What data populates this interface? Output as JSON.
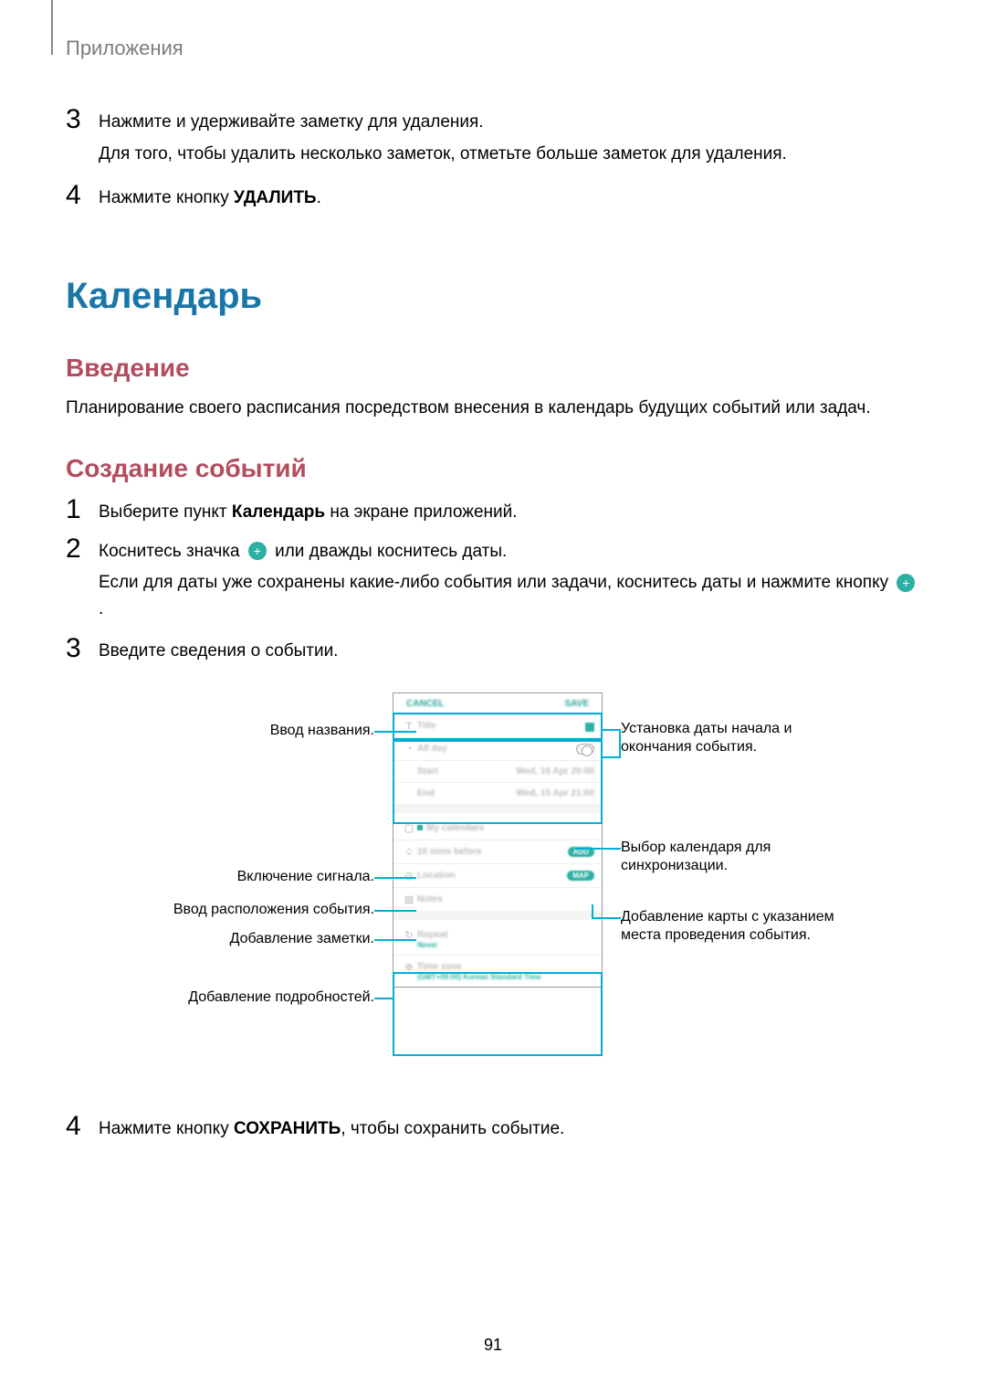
{
  "header": "Приложения",
  "steps_top": {
    "step3": {
      "num": "3",
      "line1": "Нажмите и удерживайте заметку для удаления.",
      "line2": "Для того, чтобы удалить несколько заметок, отметьте больше заметок для удаления."
    },
    "step4": {
      "num": "4",
      "prefix": "Нажмите кнопку ",
      "bold": "УДАЛИТЬ",
      "suffix": "."
    }
  },
  "section_title": "Календарь",
  "intro": {
    "heading": "Введение",
    "text": "Планирование своего расписания посредством внесения в календарь будущих событий или задач."
  },
  "create": {
    "heading": "Создание событий",
    "step1": {
      "num": "1",
      "prefix": "Выберите пункт ",
      "bold": "Календарь",
      "suffix": " на экране приложений."
    },
    "step2": {
      "num": "2",
      "part1": "Коснитесь значка ",
      "part2": " или дважды коснитесь даты.",
      "line2a": "Если для даты уже сохранены какие-либо события или задачи, коснитесь даты и нажмите кнопку ",
      "line2b": "."
    },
    "step3": {
      "num": "3",
      "text": "Введите сведения о событии."
    },
    "step4": {
      "num": "4",
      "prefix": "Нажмите кнопку ",
      "bold": "СОХРАНИТЬ",
      "suffix": ", чтобы сохранить событие."
    }
  },
  "callouts": {
    "left1": "Ввод названия.",
    "left2": "Включение сигнала.",
    "left3": "Ввод расположения события.",
    "left4": "Добавление заметки.",
    "left5": "Добавление подробностей.",
    "right1": "Установка даты начала и окончания события.",
    "right2": "Выбор календаря для синхронизации.",
    "right3": "Добавление карты с указанием места проведения события."
  },
  "phone": {
    "cancel": "CANCEL",
    "save": "SAVE",
    "title": "Title",
    "allday": "All day",
    "start": "Start",
    "end": "End",
    "date1": "Wed, 15 Apr  20:00",
    "date2": "Wed, 15 Apr  21:00",
    "calendars": "My calendars",
    "reminder": "10 mins before",
    "add": "ADD",
    "location": "Location",
    "map": "MAP",
    "notes": "Notes",
    "repeat": "Repeat",
    "never": "Never",
    "tz": "Time zone",
    "tzval": "(GMT+09:00) Korean Standard Time"
  },
  "page_number": "91",
  "plus_glyph": "+"
}
